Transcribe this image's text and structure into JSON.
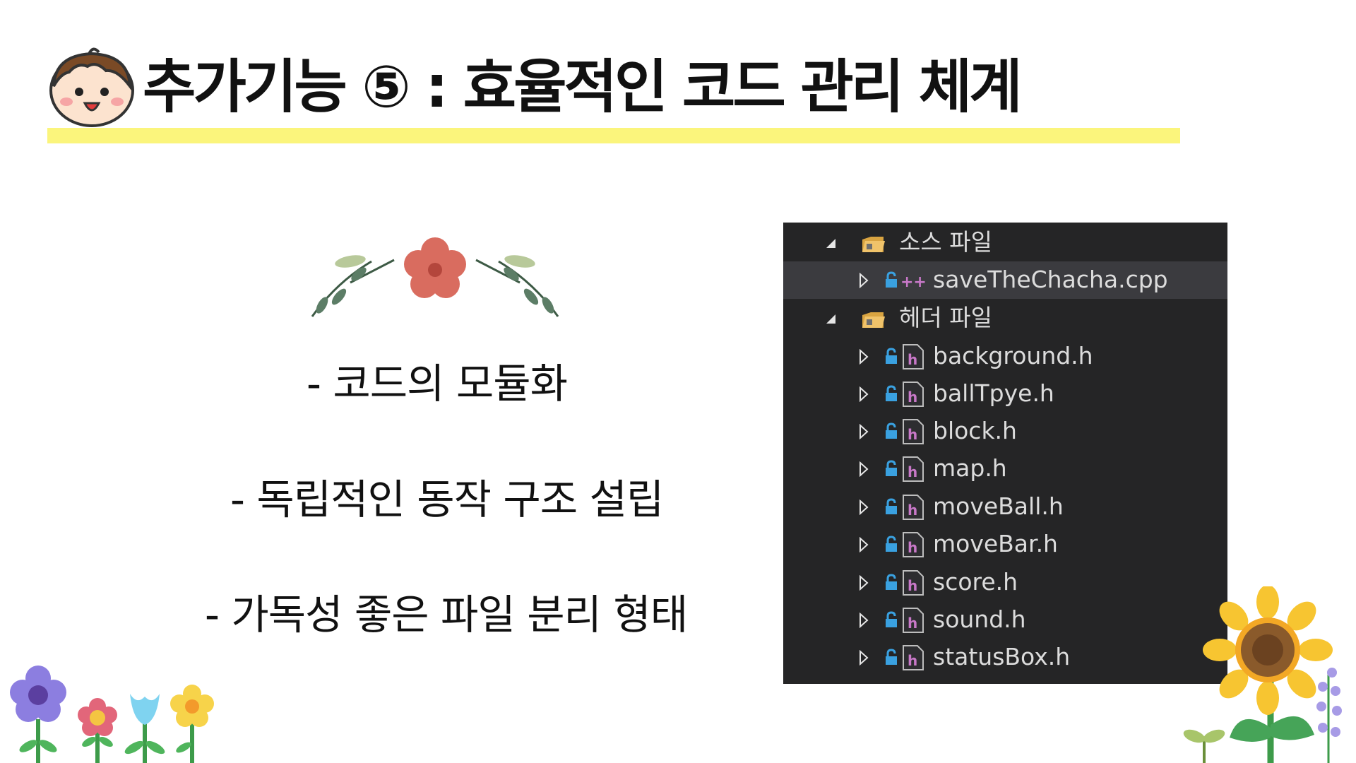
{
  "slide": {
    "title": "추가기능 ⑤ : 효율적인 코드 관리 체계",
    "bullets": [
      "- 코드의 모듈화",
      "- 독립적인 동작 구조 설립",
      "- 가독성 좋은 파일 분리 형태"
    ]
  },
  "solution_explorer": {
    "folders": [
      {
        "label": "소스 파일",
        "expanded": true,
        "files": [
          {
            "name": "saveTheChacha.cpp",
            "icon": "cpp-file-icon",
            "selected": true
          }
        ]
      },
      {
        "label": "헤더 파일",
        "expanded": true,
        "files": [
          {
            "name": "background.h",
            "icon": "header-file-icon"
          },
          {
            "name": "ballTpye.h",
            "icon": "header-file-icon"
          },
          {
            "name": "block.h",
            "icon": "header-file-icon"
          },
          {
            "name": "map.h",
            "icon": "header-file-icon"
          },
          {
            "name": "moveBall.h",
            "icon": "header-file-icon"
          },
          {
            "name": "moveBar.h",
            "icon": "header-file-icon"
          },
          {
            "name": "score.h",
            "icon": "header-file-icon"
          },
          {
            "name": "sound.h",
            "icon": "header-file-icon"
          },
          {
            "name": "statusBox.h",
            "icon": "header-file-icon"
          }
        ]
      }
    ]
  },
  "colors": {
    "title_underline": "#fbf57c",
    "explorer_background": "#252526",
    "explorer_selected_row": "#3b3b3f",
    "explorer_text": "#dcdcdc",
    "lock_icon": "#3aa1e0",
    "header_icon": "#c878c8",
    "folder_icon": "#d9a441"
  }
}
